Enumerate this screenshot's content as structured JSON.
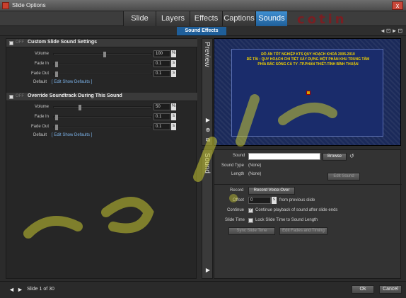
{
  "window": {
    "title": "Slide Options",
    "close_label": "x"
  },
  "tabs": [
    {
      "label": "Slide",
      "active": false
    },
    {
      "label": "Layers",
      "active": false
    },
    {
      "label": "Effects",
      "active": false
    },
    {
      "label": "Captions",
      "active": false
    },
    {
      "label": "Sounds",
      "active": true
    }
  ],
  "subtab": {
    "label": "Sound Effects"
  },
  "brand": {
    "text": "cotin"
  },
  "custom_sound": {
    "title": "Custom Slide Sound Settings",
    "toggle": "OFF",
    "rows": [
      {
        "label": "Volume",
        "value": "100",
        "unit": "%"
      },
      {
        "label": "Fade In",
        "value": "0.1",
        "unit": "s"
      },
      {
        "label": "Fade Out",
        "value": "0.1",
        "unit": "s"
      }
    ],
    "default_label": "Default",
    "default_link": "[ Edit Show Defaults ]"
  },
  "override_sound": {
    "title": "Override Soundtrack During This Sound",
    "toggle": "OFF",
    "rows": [
      {
        "label": "Volume",
        "value": "50",
        "unit": "%"
      },
      {
        "label": "Fade In",
        "value": "0.1",
        "unit": "s"
      },
      {
        "label": "Fade Out",
        "value": "0.1",
        "unit": "s"
      }
    ],
    "default_label": "Default",
    "default_link": "[ Edit Show Defaults ]"
  },
  "vtabs": {
    "preview": "Preview",
    "sound": "Sound"
  },
  "slide_text": {
    "line1": "ĐỒ ÁN TỐT NGHIỆP KTS QUY HOẠCH KHOÁ 2005-2010",
    "line2": "ĐỀ TÀI : QUY HOẠCH CHI TIẾT XÂY DỰNG MỘT PHẦN KHU TRUNG TÂM",
    "line3": "PHÍA BẮC SÔNG CÀ TY -TP.PHAN THIẾT-TỈNH BÌNH THUẬN"
  },
  "sound_panel": {
    "sound_label": "Sound",
    "sound_value": "",
    "browse_label": "Browse",
    "sound_type_label": "Sound Type",
    "sound_type_value": "(None)",
    "length_label": "Length",
    "length_value": "(None)",
    "edit_sound_label": "Edit Sound",
    "record_label": "Record",
    "record_button": "Record Voice-Over",
    "offset_label": "Offset",
    "offset_value": "0",
    "offset_unit": "s",
    "offset_suffix": "from previous slide",
    "continue_label": "Continue",
    "continue_text": "Continue playback of sound after slide ends",
    "slide_time_label": "Slide Time",
    "slide_time_text": "Lock Slide Time to Sound Length",
    "sync_button": "Sync Slide Time",
    "edit_fades_button": "Edit Fades and Timing"
  },
  "footer": {
    "slide_info": "Slide 1 of 30",
    "ok_label": "Ok",
    "cancel_label": "Cancel"
  },
  "colors": {
    "accent": "#1f5f9a",
    "brand": "#7a1e22",
    "slide_text": "#f2d200",
    "watermark": "#c8c832"
  }
}
